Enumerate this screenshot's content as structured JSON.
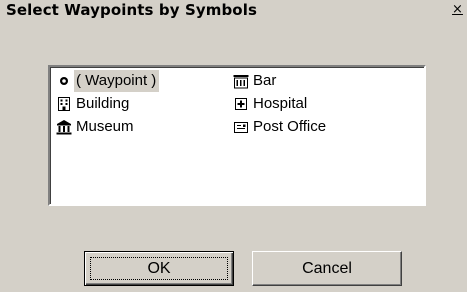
{
  "window": {
    "title": "Select Waypoints by Symbols",
    "close_glyph": "×"
  },
  "list": {
    "items": [
      {
        "label": "( Waypoint )",
        "icon": "waypoint-dot-icon",
        "selected": true
      },
      {
        "label": "Building",
        "icon": "building-icon"
      },
      {
        "label": "Museum",
        "icon": "museum-icon"
      },
      {
        "label": "Bar",
        "icon": "bar-icon"
      },
      {
        "label": "Hospital",
        "icon": "hospital-icon"
      },
      {
        "label": "Post Office",
        "icon": "post-office-icon"
      }
    ]
  },
  "buttons": {
    "ok_label": "OK",
    "cancel_label": "Cancel"
  }
}
